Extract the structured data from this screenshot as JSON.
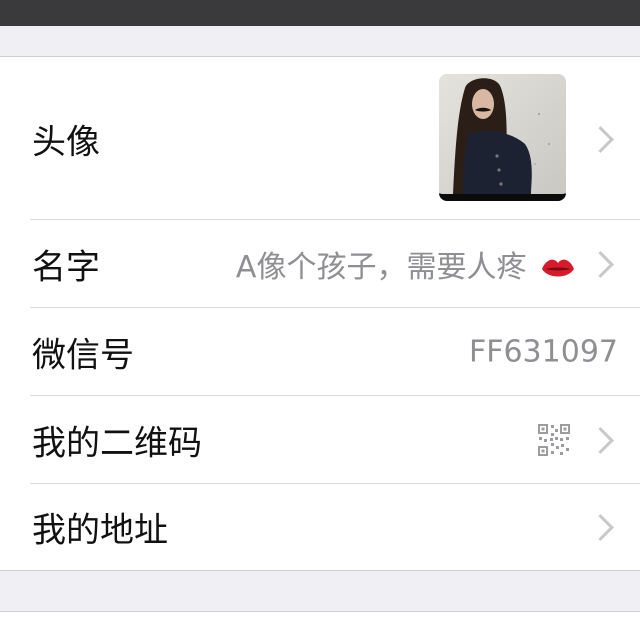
{
  "profile": {
    "avatar": {
      "label": "头像"
    },
    "name": {
      "label": "名字",
      "value": "A像个孩子，需要人疼",
      "emoji": "lips-icon"
    },
    "wechat_id": {
      "label": "微信号",
      "value": "FF631097"
    },
    "qr_code": {
      "label": "我的二维码",
      "icon": "qr-code-icon"
    },
    "address": {
      "label": "我的地址"
    }
  },
  "colors": {
    "background": "#efeff4",
    "cell": "#ffffff",
    "separator": "#dcdce0",
    "label_text": "#111111",
    "value_text": "#8e8e93",
    "chevron": "#c7c7cc",
    "status_bar": "#3a3a3c",
    "lips": "#d81b2b"
  }
}
